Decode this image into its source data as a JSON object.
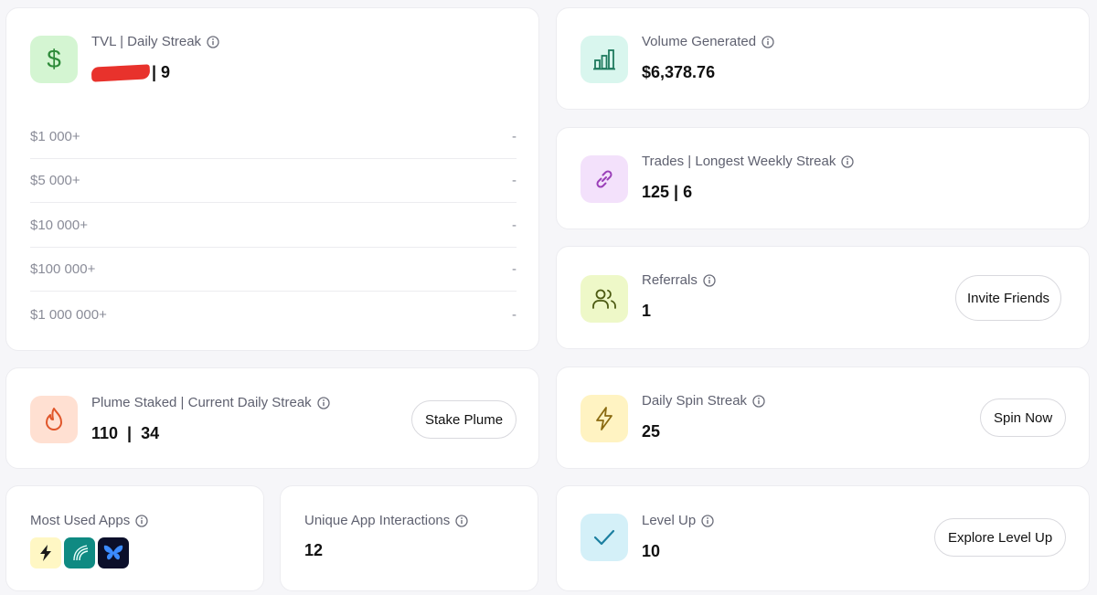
{
  "tvl": {
    "label": "TVL | Daily Streak",
    "value_suffix": "| 9",
    "tiers": [
      {
        "threshold": "$1 000+",
        "value": "-"
      },
      {
        "threshold": "$5 000+",
        "value": "-"
      },
      {
        "threshold": "$10 000+",
        "value": "-"
      },
      {
        "threshold": "$100 000+",
        "value": "-"
      },
      {
        "threshold": "$1 000 000+",
        "value": "-"
      }
    ]
  },
  "volume": {
    "label": "Volume Generated",
    "value": "$6,378.76"
  },
  "trades": {
    "label": "Trades | Longest Weekly Streak",
    "value": "125 | 6"
  },
  "referrals": {
    "label": "Referrals",
    "value": "1",
    "button": "Invite Friends"
  },
  "plume": {
    "label": "Plume Staked | Current Daily Streak",
    "value": "110  |  34",
    "button": "Stake Plume"
  },
  "spin": {
    "label": "Daily Spin Streak",
    "value": "25",
    "button": "Spin Now"
  },
  "apps": {
    "label": "Most Used Apps"
  },
  "interactions": {
    "label": "Unique App Interactions",
    "value": "12"
  },
  "level": {
    "label": "Level Up",
    "value": "10",
    "button": "Explore Level Up"
  },
  "icons": {
    "tvl": "dollar-icon",
    "volume": "bar-chart-icon",
    "trades": "link-icon",
    "referrals": "users-icon",
    "plume": "flame-icon",
    "spin": "lightning-icon",
    "level": "check-icon"
  },
  "colors": {
    "green_bg": "#d4f5d2",
    "green_fg": "#2e8b3a",
    "mint_bg": "#d9f6ee",
    "mint_fg": "#1e7a5e",
    "purple_bg": "#f3e1fb",
    "purple_fg": "#9a3fb8",
    "lime_bg": "#eef8c8",
    "lime_fg": "#4c5a12",
    "peach_bg": "#ffe0d2",
    "peach_fg": "#e0562a",
    "yellow_bg": "#fff3c2",
    "yellow_fg": "#8a6a10",
    "cyan_bg": "#d4f0f8",
    "cyan_fg": "#1c7fa0"
  }
}
